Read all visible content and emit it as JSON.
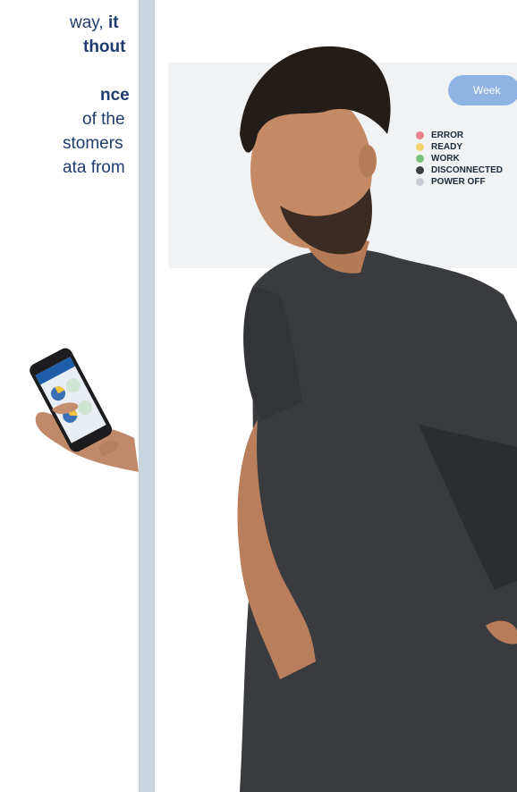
{
  "text_block": {
    "line1_a": "way,",
    "line1_b": "it",
    "line2": "thout",
    "line3": "nce",
    "line4": "of the",
    "line5": "stomers",
    "line6": "ata from"
  },
  "screen": {
    "period_button": "Week",
    "legend": [
      {
        "label": "ERROR",
        "color": "#e8828e"
      },
      {
        "label": "READY",
        "color": "#f3d36b"
      },
      {
        "label": "WORK",
        "color": "#79c17a"
      },
      {
        "label": "DISCONNECTED",
        "color": "#3d3f45"
      },
      {
        "label": "POWER OFF",
        "color": "#c9ced6"
      }
    ]
  },
  "colors": {
    "text": "#1f3c6e",
    "divider": "#c9d5de",
    "shirt": "#3a3b3e"
  }
}
